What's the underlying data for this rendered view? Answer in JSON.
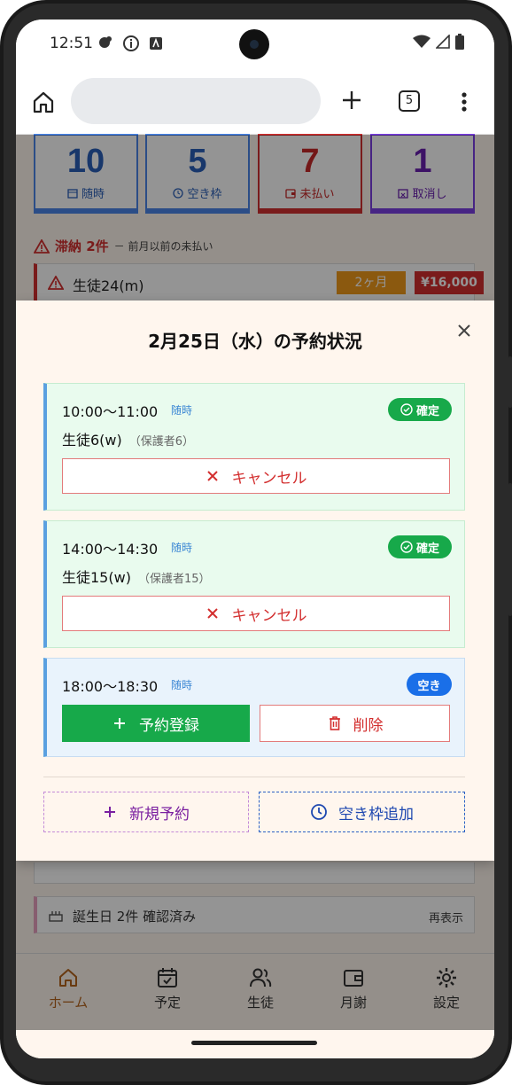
{
  "statusbar": {
    "time": "12:51"
  },
  "browser": {
    "tab_count": "5"
  },
  "stats": [
    {
      "value": "10",
      "label": "随時",
      "color": "#2a5fb8"
    },
    {
      "value": "5",
      "label": "空き枠",
      "color": "#2a5fb8"
    },
    {
      "value": "7",
      "label": "未払い",
      "color": "#c62828"
    },
    {
      "value": "1",
      "label": "取消し",
      "color": "#6a1fb0"
    }
  ],
  "arrears": {
    "title": "滞納 2件",
    "subtitle": "－ 前月以前の未払い",
    "row": {
      "name": "生徒24(m)",
      "months": "2ヶ月",
      "amount": "¥16,000"
    }
  },
  "birthday": {
    "text": "誕生日 2件 確認済み",
    "action": "再表示"
  },
  "modal": {
    "title": "2月25日（水）の予約状況",
    "slots": [
      {
        "time": "10:00〜11:00",
        "type": "随時",
        "status": "確定",
        "student": "生徒6(w)",
        "guardian": "（保護者6）",
        "cancel_label": "キャンセル"
      },
      {
        "time": "14:00〜14:30",
        "type": "随時",
        "status": "確定",
        "student": "生徒15(w)",
        "guardian": "（保護者15）",
        "cancel_label": "キャンセル"
      },
      {
        "time": "18:00〜18:30",
        "type": "随時",
        "status": "空き",
        "book_label": "予約登録",
        "delete_label": "削除"
      }
    ],
    "new_booking_label": "新規予約",
    "add_slot_label": "空き枠追加"
  },
  "bottom_nav": [
    {
      "label": "ホーム",
      "icon": "home-icon",
      "active": true
    },
    {
      "label": "予定",
      "icon": "calendar-check-icon",
      "active": false
    },
    {
      "label": "生徒",
      "icon": "users-icon",
      "active": false
    },
    {
      "label": "月謝",
      "icon": "wallet-icon",
      "active": false
    },
    {
      "label": "設定",
      "icon": "gear-icon",
      "active": false
    }
  ]
}
